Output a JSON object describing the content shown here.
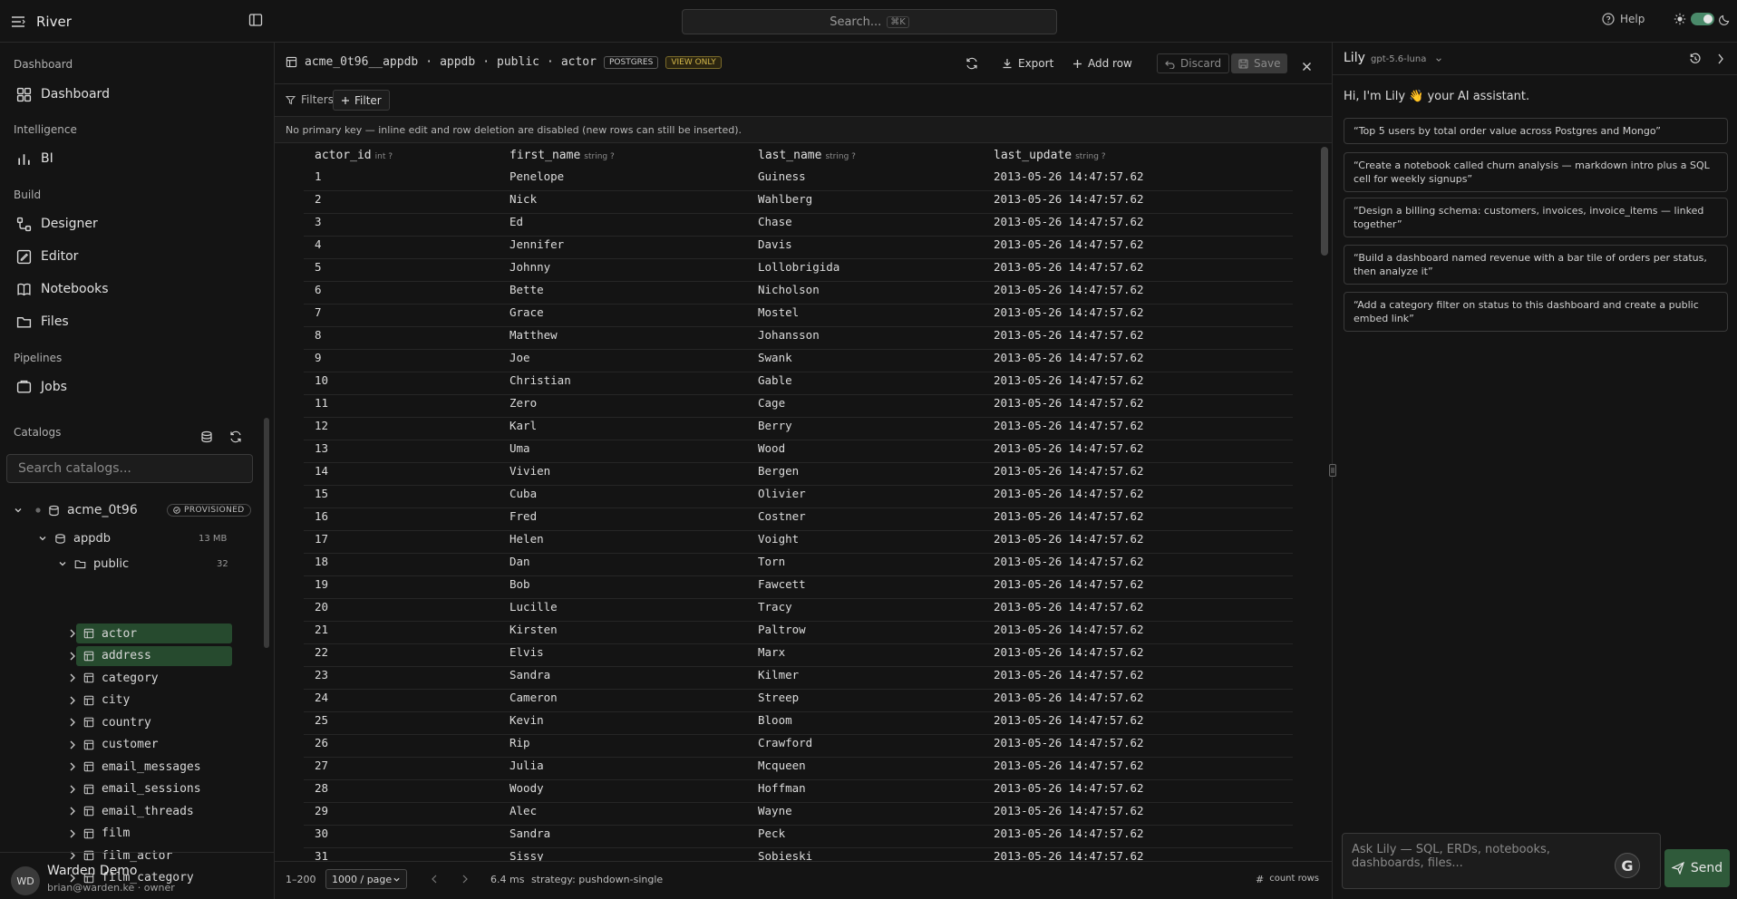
{
  "app": {
    "name": "River"
  },
  "search": {
    "label": "Search...",
    "shortcut": "⌘K"
  },
  "topbar": {
    "help": "Help"
  },
  "sidebar": {
    "sections": [
      {
        "label": "Dashboard",
        "items": [
          {
            "label": "Dashboard",
            "icon": "grid-icon"
          }
        ]
      },
      {
        "label": "Intelligence",
        "items": [
          {
            "label": "BI",
            "icon": "bar-chart-icon"
          }
        ]
      },
      {
        "label": "Build",
        "items": [
          {
            "label": "Designer",
            "icon": "designer-icon"
          },
          {
            "label": "Editor",
            "icon": "editor-icon"
          },
          {
            "label": "Notebooks",
            "icon": "notebook-icon"
          },
          {
            "label": "Files",
            "icon": "folder-icon"
          }
        ]
      },
      {
        "label": "Pipelines",
        "items": [
          {
            "label": "Jobs",
            "icon": "jobs-icon"
          }
        ]
      }
    ],
    "catalogs": {
      "label": "Catalogs",
      "search_placeholder": "Search catalogs...",
      "connection": {
        "name": "acme_0t96",
        "badge": "PROVISIONED"
      },
      "database": {
        "name": "appdb",
        "size": "13 MB"
      },
      "schema": {
        "name": "public",
        "count": "32"
      },
      "tables": [
        "actor",
        "address",
        "category",
        "city",
        "country",
        "customer",
        "email_messages",
        "email_sessions",
        "email_threads",
        "film",
        "film_actor",
        "film_category"
      ],
      "selected": [
        "actor",
        "address"
      ]
    },
    "user": {
      "initials": "WD",
      "name": "Warden Demo",
      "email": "brian@warden.ke · owner"
    }
  },
  "main": {
    "breadcrumb": [
      "acme_0t96__appdb",
      "appdb",
      "public",
      "actor"
    ],
    "badges": {
      "engine": "POSTGRES",
      "mode": "VIEW ONLY"
    },
    "toolbar": {
      "export": "Export",
      "add_row": "Add row",
      "discard": "Discard",
      "save": "Save"
    },
    "filters": {
      "label": "Filters",
      "button": "Filter"
    },
    "notice": "No primary key — inline edit and row deletion are disabled (new rows can still be inserted).",
    "columns": [
      {
        "name": "actor_id",
        "type": "int ?"
      },
      {
        "name": "first_name",
        "type": "string ?"
      },
      {
        "name": "last_name",
        "type": "string ?"
      },
      {
        "name": "last_update",
        "type": "string ?"
      }
    ],
    "rows": [
      [
        "1",
        "Penelope",
        "Guiness",
        "2013-05-26 14:47:57.62"
      ],
      [
        "2",
        "Nick",
        "Wahlberg",
        "2013-05-26 14:47:57.62"
      ],
      [
        "3",
        "Ed",
        "Chase",
        "2013-05-26 14:47:57.62"
      ],
      [
        "4",
        "Jennifer",
        "Davis",
        "2013-05-26 14:47:57.62"
      ],
      [
        "5",
        "Johnny",
        "Lollobrigida",
        "2013-05-26 14:47:57.62"
      ],
      [
        "6",
        "Bette",
        "Nicholson",
        "2013-05-26 14:47:57.62"
      ],
      [
        "7",
        "Grace",
        "Mostel",
        "2013-05-26 14:47:57.62"
      ],
      [
        "8",
        "Matthew",
        "Johansson",
        "2013-05-26 14:47:57.62"
      ],
      [
        "9",
        "Joe",
        "Swank",
        "2013-05-26 14:47:57.62"
      ],
      [
        "10",
        "Christian",
        "Gable",
        "2013-05-26 14:47:57.62"
      ],
      [
        "11",
        "Zero",
        "Cage",
        "2013-05-26 14:47:57.62"
      ],
      [
        "12",
        "Karl",
        "Berry",
        "2013-05-26 14:47:57.62"
      ],
      [
        "13",
        "Uma",
        "Wood",
        "2013-05-26 14:47:57.62"
      ],
      [
        "14",
        "Vivien",
        "Bergen",
        "2013-05-26 14:47:57.62"
      ],
      [
        "15",
        "Cuba",
        "Olivier",
        "2013-05-26 14:47:57.62"
      ],
      [
        "16",
        "Fred",
        "Costner",
        "2013-05-26 14:47:57.62"
      ],
      [
        "17",
        "Helen",
        "Voight",
        "2013-05-26 14:47:57.62"
      ],
      [
        "18",
        "Dan",
        "Torn",
        "2013-05-26 14:47:57.62"
      ],
      [
        "19",
        "Bob",
        "Fawcett",
        "2013-05-26 14:47:57.62"
      ],
      [
        "20",
        "Lucille",
        "Tracy",
        "2013-05-26 14:47:57.62"
      ],
      [
        "21",
        "Kirsten",
        "Paltrow",
        "2013-05-26 14:47:57.62"
      ],
      [
        "22",
        "Elvis",
        "Marx",
        "2013-05-26 14:47:57.62"
      ],
      [
        "23",
        "Sandra",
        "Kilmer",
        "2013-05-26 14:47:57.62"
      ],
      [
        "24",
        "Cameron",
        "Streep",
        "2013-05-26 14:47:57.62"
      ],
      [
        "25",
        "Kevin",
        "Bloom",
        "2013-05-26 14:47:57.62"
      ],
      [
        "26",
        "Rip",
        "Crawford",
        "2013-05-26 14:47:57.62"
      ],
      [
        "27",
        "Julia",
        "Mcqueen",
        "2013-05-26 14:47:57.62"
      ],
      [
        "28",
        "Woody",
        "Hoffman",
        "2013-05-26 14:47:57.62"
      ],
      [
        "29",
        "Alec",
        "Wayne",
        "2013-05-26 14:47:57.62"
      ],
      [
        "30",
        "Sandra",
        "Peck",
        "2013-05-26 14:47:57.62"
      ],
      [
        "31",
        "Sissy",
        "Sobieski",
        "2013-05-26 14:47:57.62"
      ]
    ],
    "footer": {
      "range": "1–200",
      "page_size": "1000 / page",
      "timing": "6.4 ms",
      "strategy": "strategy: pushdown-single",
      "count_rows": "count rows"
    }
  },
  "lily": {
    "name": "Lily",
    "model": "gpt-5.6-luna",
    "greeting": "Hi, I'm Lily 👋 your AI assistant.",
    "suggestions": [
      "“Top 5 users by total order value across Postgres and Mongo”",
      "“Create a notebook called churn analysis — markdown intro plus a SQL cell for weekly signups”",
      "“Design a billing schema: customers, invoices, invoice_items — linked together”",
      "“Build a dashboard named revenue with a bar tile of orders per status, then analyze it”",
      "“Add a category filter on status to this dashboard and create a public embed link”"
    ],
    "input_placeholder": "Ask Lily — SQL, ERDs, notebooks, dashboards, files...",
    "send": "Send"
  },
  "colors": {
    "background": "#141414",
    "accent": "#2f5a3a",
    "selected": "#264a2e",
    "warning": "#d4b84a"
  }
}
